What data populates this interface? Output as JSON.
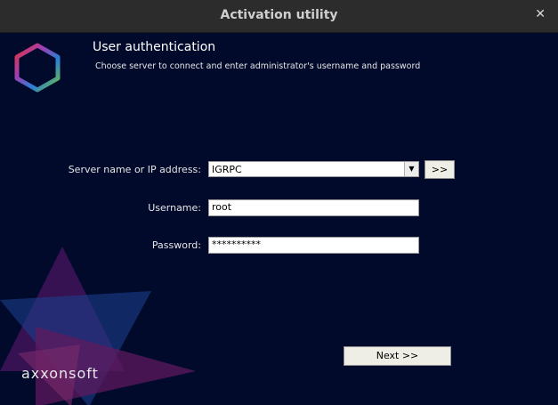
{
  "window": {
    "title": "Activation utility",
    "close_glyph": "✕"
  },
  "header": {
    "heading": "User authentication",
    "subheading": "Choose server to connect and enter administrator's username and password"
  },
  "form": {
    "server_label": "Server name or IP address:",
    "server_value": "IGRPC",
    "browse_button": ">>",
    "username_label": "Username:",
    "username_value": "root",
    "password_label": "Password:",
    "password_value": "**********"
  },
  "next_button": "Next >>",
  "brand": "axxonsoft",
  "icons": [
    "hexagon-logo-icon",
    "chevron-down-icon",
    "close-icon"
  ],
  "colors": {
    "background": "#020a2c",
    "titlebar": "#2c2c2c",
    "button": "#efeee6"
  }
}
